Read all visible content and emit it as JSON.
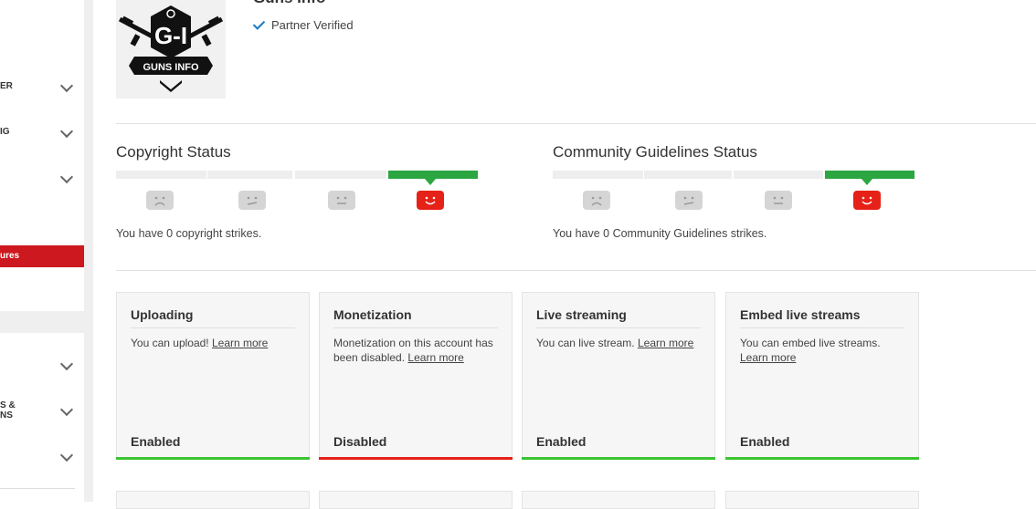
{
  "sidebar": {
    "items": [
      {
        "label": "ER"
      },
      {
        "label": "IG"
      },
      {
        "label": ""
      },
      {
        "label": "S &\nNS"
      },
      {
        "label": ""
      }
    ],
    "active_label": "ures"
  },
  "channel": {
    "title": "Guns Info",
    "verified_text": "Partner Verified",
    "logo_text": "G-I",
    "logo_subtext": "GUNS INFO"
  },
  "copyright": {
    "title": "Copyright Status",
    "strikes_text": "You have 0 copyright strikes."
  },
  "community": {
    "title": "Community Guidelines Status",
    "strikes_text": "You have 0 Community Guidelines strikes."
  },
  "cards": [
    {
      "title": "Uploading",
      "body": "You can upload!",
      "link": "Learn more",
      "status": "Enabled",
      "status_color": "#3ac432"
    },
    {
      "title": "Monetization",
      "body": "Monetization on this account has been disabled.",
      "link": "Learn more",
      "status": "Disabled",
      "status_color": "#e62117"
    },
    {
      "title": "Live streaming",
      "body": "You can live stream.",
      "link": "Learn more",
      "status": "Enabled",
      "status_color": "#3ac432"
    },
    {
      "title": "Embed live streams",
      "body": "You can embed live streams.",
      "link": "Learn more",
      "status": "Enabled",
      "status_color": "#3ac432"
    }
  ],
  "colors": {
    "accent_red": "#cc181e",
    "enabled_green": "#3ac432",
    "status_green": "#2ba640",
    "verified_blue": "#167ac6"
  }
}
